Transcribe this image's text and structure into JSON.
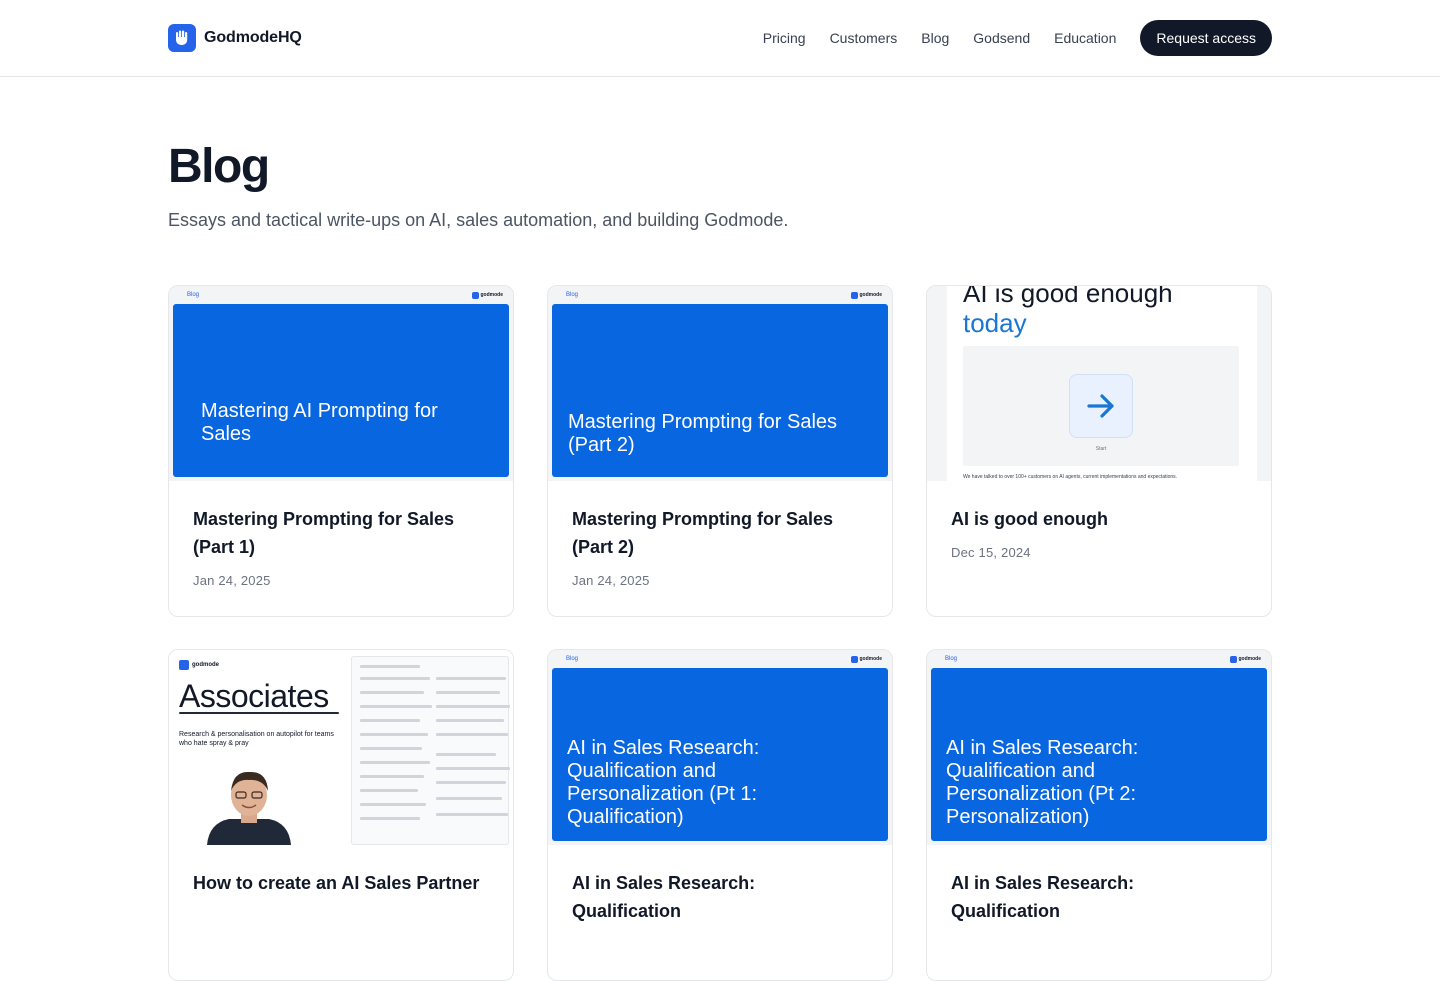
{
  "brand": {
    "name": "GodmodeHQ"
  },
  "nav": {
    "links": [
      "Pricing",
      "Customers",
      "Blog",
      "Godsend",
      "Education"
    ],
    "cta": "Request access"
  },
  "hero": {
    "title": "Blog",
    "subtitle": "Essays and tactical write-ups on AI, sales automation, and building Godmode."
  },
  "thumb": {
    "tag": "Blog",
    "mini_brand": "godmode"
  },
  "posts": [
    {
      "title": "Mastering Prompting for Sales (Part 1)",
      "date": "Jan 24, 2025",
      "thumb_text": "Mastering AI Prompting for Sales"
    },
    {
      "title": "Mastering Prompting for Sales (Part 2)",
      "date": "Jan 24, 2025",
      "thumb_text": "Mastering Prompting for Sales (Part 2)"
    },
    {
      "title": "AI is good enough",
      "date": "Dec 15, 2024",
      "thumb_line1": "AI is good enough",
      "thumb_line2": "today",
      "thumb_start": "Start",
      "thumb_foot": "We have talked to over 100+ customers on AI agents, current implementations and expectations."
    },
    {
      "title": "How to create an AI Sales Partner",
      "date": "",
      "thumb_word": "Associates",
      "thumb_tagline": "Research & personalisation on autopilot for teams who hate spray & pray"
    },
    {
      "title": "AI in Sales Research: Qualification",
      "date": "",
      "thumb_text": "AI in Sales Research: Qualification and Personalization (Pt 1: Qualification)"
    },
    {
      "title": "AI in Sales Research: Qualification",
      "date": "",
      "thumb_text": "AI in Sales Research: Qualification and Personalization (Pt 2: Personalization)"
    }
  ],
  "colors": {
    "accent": "#2563eb",
    "thumb_blue": "#0866e0",
    "cta_bg": "#111827",
    "text": "#111827",
    "muted": "#6b7280"
  },
  "icons": [
    "hand-logo-icon",
    "arrow-right-icon"
  ]
}
